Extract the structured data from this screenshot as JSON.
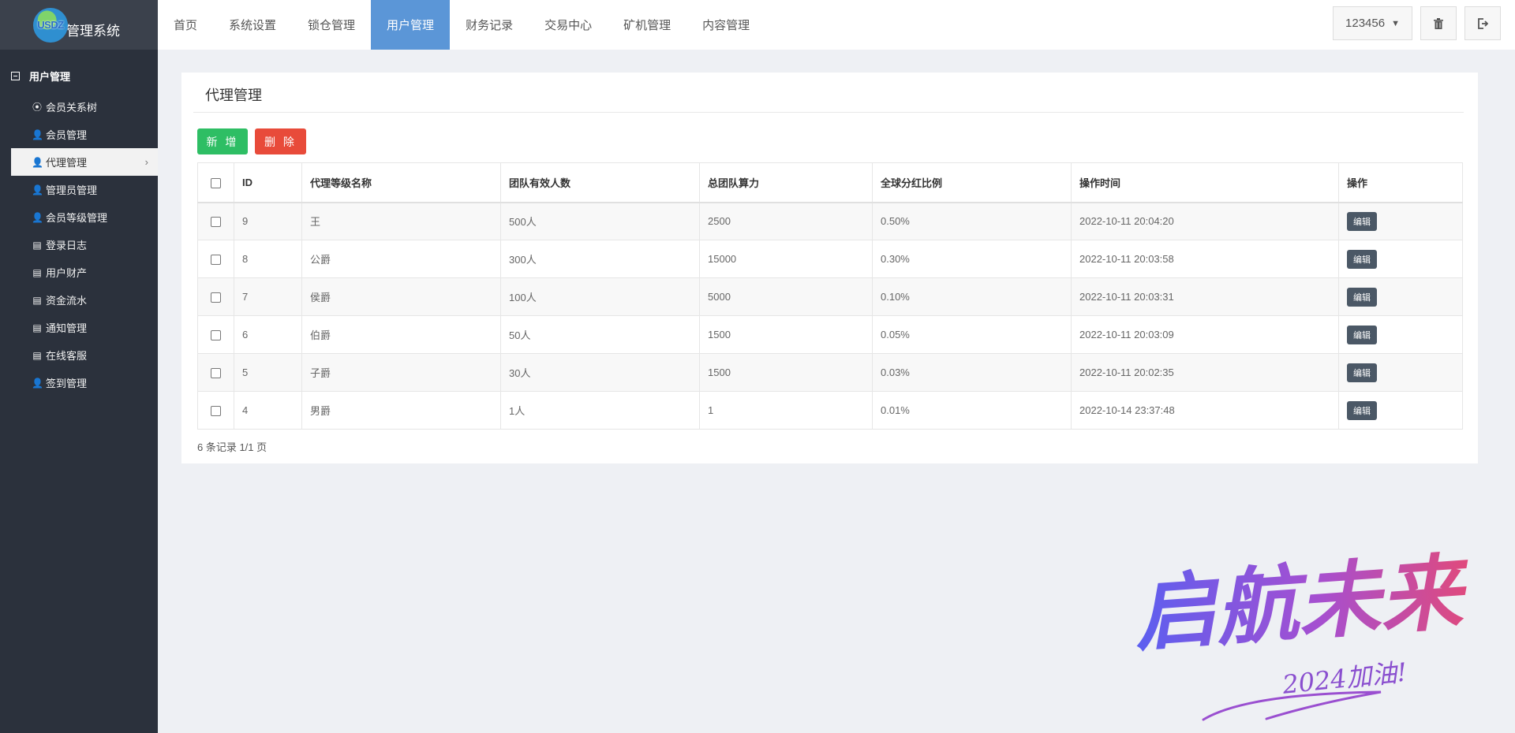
{
  "logo": {
    "badge": "USDZ",
    "title": "管理系统"
  },
  "sidebar": {
    "section": "用户管理",
    "items": [
      {
        "label": "会员关系树",
        "icon": "target-icon"
      },
      {
        "label": "会员管理",
        "icon": "user-icon"
      },
      {
        "label": "代理管理",
        "icon": "user-icon",
        "active": true
      },
      {
        "label": "管理员管理",
        "icon": "user-icon"
      },
      {
        "label": "会员等级管理",
        "icon": "user-icon"
      },
      {
        "label": "登录日志",
        "icon": "list-icon"
      },
      {
        "label": "用户财产",
        "icon": "list-icon"
      },
      {
        "label": "资金流水",
        "icon": "list-icon"
      },
      {
        "label": "通知管理",
        "icon": "list-icon"
      },
      {
        "label": "在线客服",
        "icon": "list-icon"
      },
      {
        "label": "签到管理",
        "icon": "user-icon"
      }
    ]
  },
  "nav": {
    "tabs": [
      "首页",
      "系统设置",
      "锁仓管理",
      "用户管理",
      "财务记录",
      "交易中心",
      "矿机管理",
      "内容管理"
    ],
    "active_index": 3,
    "user": "123456"
  },
  "panel": {
    "title": "代理管理",
    "add_label": "新 增",
    "delete_label": "删 除",
    "columns": [
      "ID",
      "代理等级名称",
      "团队有效人数",
      "总团队算力",
      "全球分红比例",
      "操作时间",
      "操作"
    ],
    "rows": [
      {
        "id": "9",
        "name": "王",
        "members": "500人",
        "power": "2500",
        "ratio": "0.50%",
        "time": "2022-10-11 20:04:20"
      },
      {
        "id": "8",
        "name": "公爵",
        "members": "300人",
        "power": "15000",
        "ratio": "0.30%",
        "time": "2022-10-11 20:03:58"
      },
      {
        "id": "7",
        "name": "侯爵",
        "members": "100人",
        "power": "5000",
        "ratio": "0.10%",
        "time": "2022-10-11 20:03:31"
      },
      {
        "id": "6",
        "name": "伯爵",
        "members": "50人",
        "power": "1500",
        "ratio": "0.05%",
        "time": "2022-10-11 20:03:09"
      },
      {
        "id": "5",
        "name": "子爵",
        "members": "30人",
        "power": "1500",
        "ratio": "0.03%",
        "time": "2022-10-11 20:02:35"
      },
      {
        "id": "4",
        "name": "男爵",
        "members": "1人",
        "power": "1",
        "ratio": "0.01%",
        "time": "2022-10-14 23:37:48"
      }
    ],
    "edit_label": "编辑",
    "footer": "6 条记录 1/1 页"
  },
  "watermark": {
    "main": "启航未来",
    "sub": "2024加油!"
  },
  "colors": {
    "sidebar": "#2b313c",
    "nav_active": "#5b96d7",
    "add": "#2ebe64",
    "delete": "#e84b3a",
    "edit": "#4b5866"
  }
}
